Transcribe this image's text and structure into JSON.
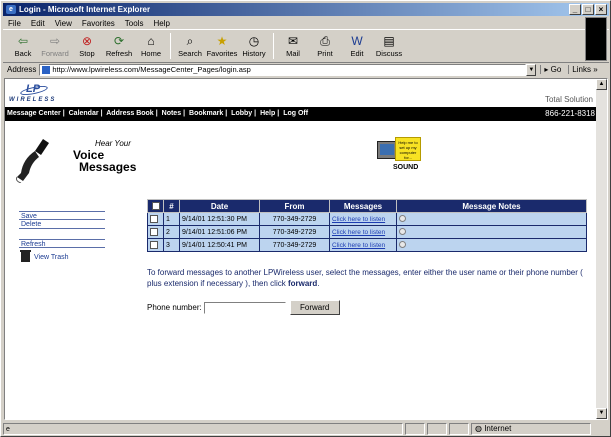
{
  "window": {
    "title": "Login - Microsoft Internet Explorer"
  },
  "menu": [
    "File",
    "Edit",
    "View",
    "Favorites",
    "Tools",
    "Help"
  ],
  "toolbar": [
    {
      "label": "Back",
      "icon": "back-icon",
      "enabled": true
    },
    {
      "label": "Forward",
      "icon": "forward-icon",
      "enabled": false
    },
    {
      "label": "Stop",
      "icon": "stop-icon",
      "enabled": true
    },
    {
      "label": "Refresh",
      "icon": "refresh-icon",
      "enabled": true
    },
    {
      "label": "Home",
      "icon": "home-icon",
      "enabled": true
    },
    {
      "label": "Search",
      "icon": "search-icon",
      "enabled": true
    },
    {
      "label": "Favorites",
      "icon": "favorites-icon",
      "enabled": true
    },
    {
      "label": "History",
      "icon": "history-icon",
      "enabled": true
    },
    {
      "label": "Mail",
      "icon": "mail-icon",
      "enabled": true
    },
    {
      "label": "Print",
      "icon": "print-icon",
      "enabled": true
    },
    {
      "label": "Edit",
      "icon": "edit-icon",
      "enabled": true
    },
    {
      "label": "Discuss",
      "icon": "discuss-icon",
      "enabled": true
    }
  ],
  "address": {
    "label": "Address",
    "url": "http://www.lpwireless.com/MessageCenter_Pages/login.asp",
    "go": "Go",
    "links": "Links"
  },
  "site": {
    "logo_text": "WIRELESS",
    "tagline": "Total Solution",
    "phone": "866-221-8318",
    "nav": [
      "Message Center",
      "Calendar",
      "Address Book",
      "Notes",
      "Bookmark",
      "Lobby",
      "Help",
      "Log Off"
    ],
    "banner_line1": "Hear Your",
    "banner_line2": "Voice",
    "banner_line3": "Messages",
    "sound_help": "Help me to set up my computer for...",
    "sound_label": "SOUND"
  },
  "sidebar": {
    "save": "Save",
    "delete": "Delete",
    "refresh": "Refresh",
    "view_trash": "View Trash"
  },
  "table": {
    "headers": [
      "#",
      "Date",
      "From",
      "Messages",
      "Message Notes"
    ],
    "rows": [
      {
        "num": "1",
        "date": "9/14/01 12:51:30 PM",
        "from": "770-349-2729",
        "link": "Click here to listen"
      },
      {
        "num": "2",
        "date": "9/14/01 12:51:06 PM",
        "from": "770-349-2729",
        "link": "Click here to listen"
      },
      {
        "num": "3",
        "date": "9/14/01 12:50:41 PM",
        "from": "770-349-2729",
        "link": "Click here to listen"
      }
    ]
  },
  "instructions": {
    "text": "To forward messages to another LPWireless user, select the messages, enter either the user name or their phone number ( plus extension if necessary ), then click ",
    "bold": "forward",
    "end": "."
  },
  "forward": {
    "label": "Phone number:",
    "button": "Forward"
  },
  "status": {
    "zone": "Internet"
  }
}
